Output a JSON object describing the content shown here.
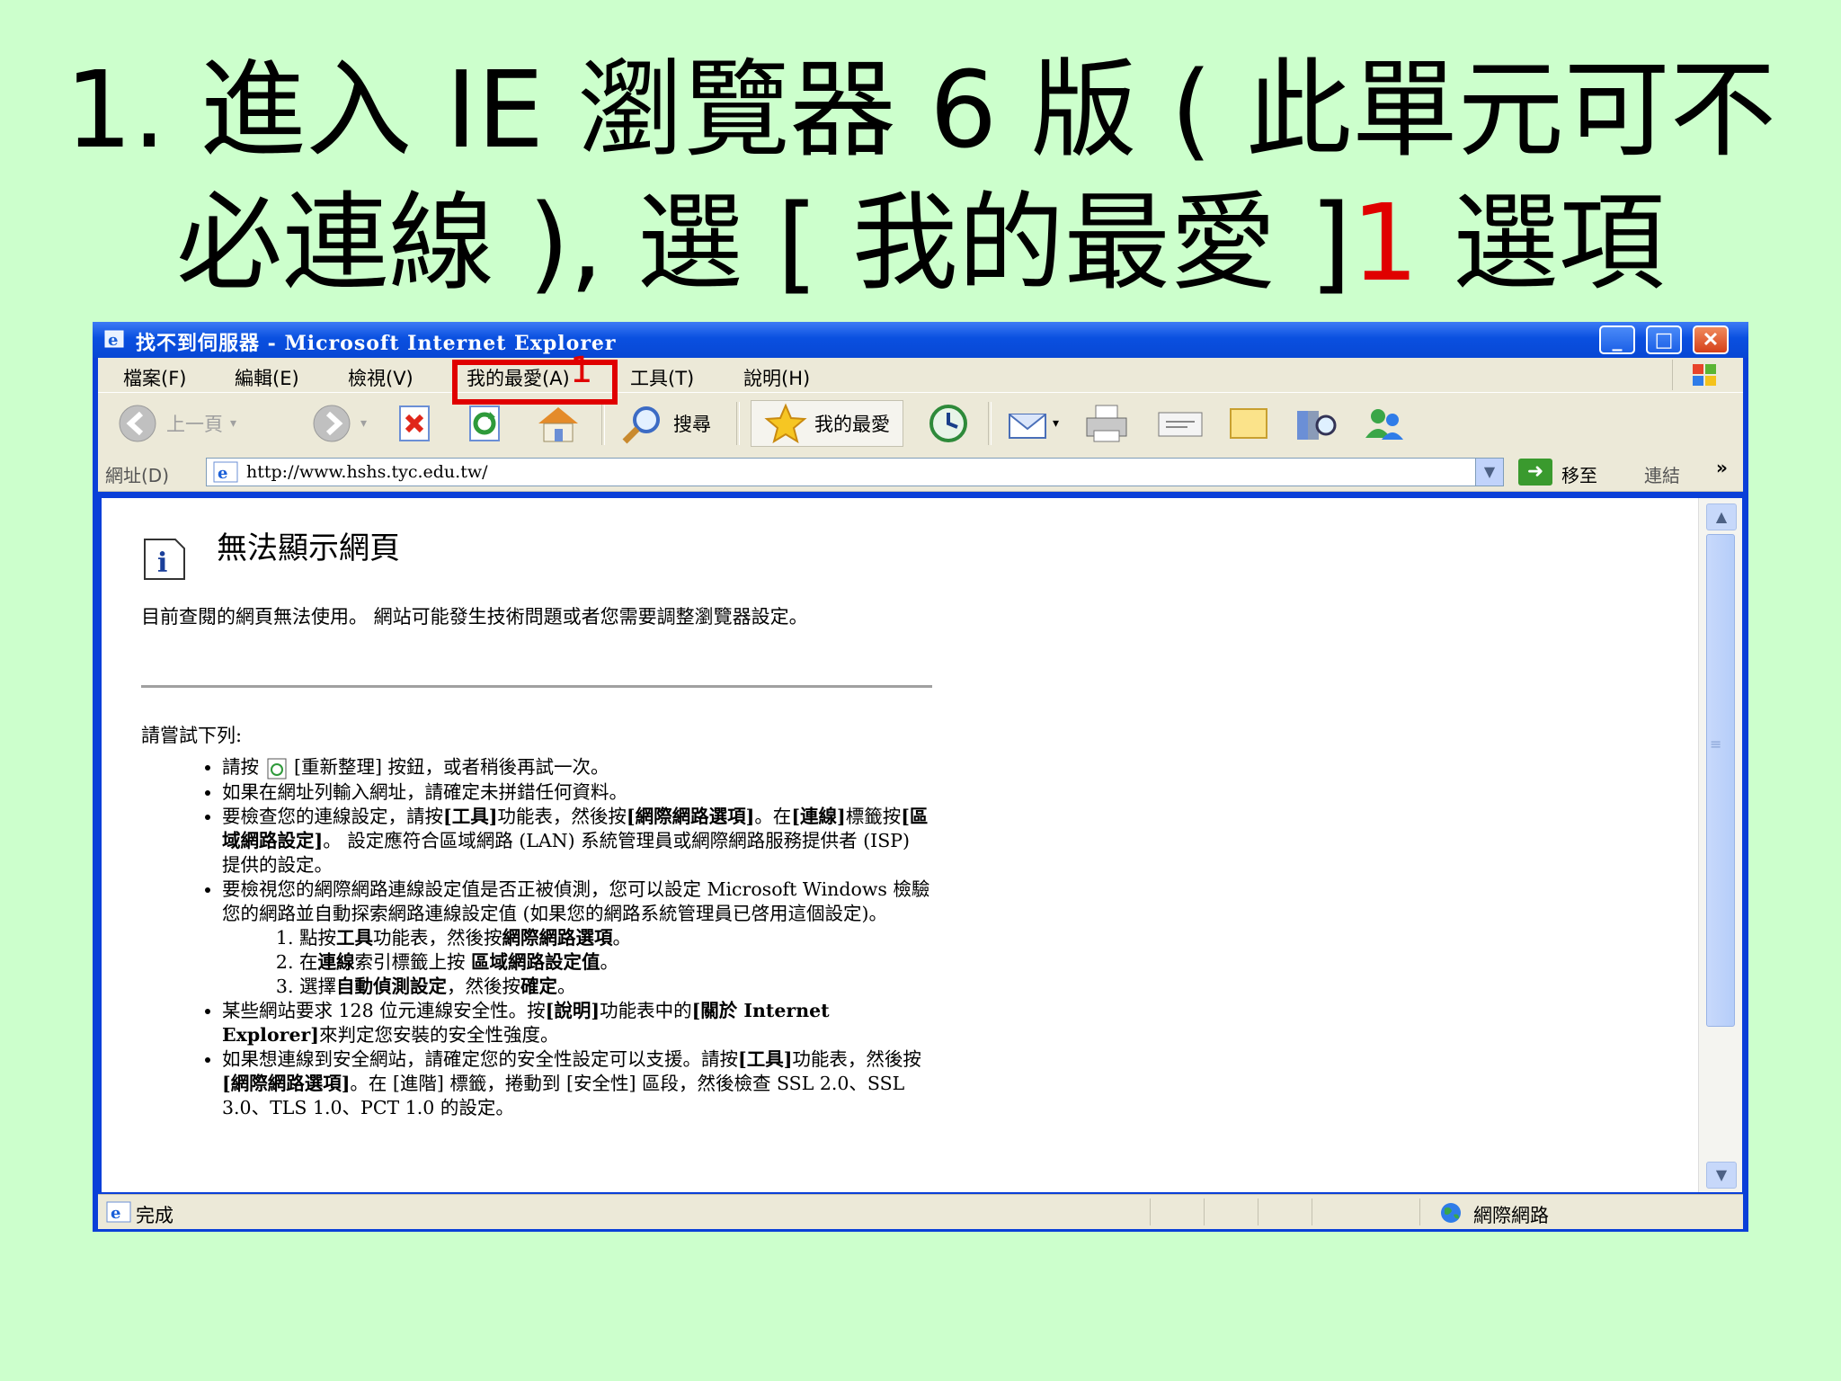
{
  "slide": {
    "title_line1": "1. 進入 IE 瀏覽器 6 版 ( 此單元可不",
    "title_line2_a": "必連線 ),  選 [ 我的最愛 ]",
    "title_line2_num": "1",
    "title_line2_b": " 選項",
    "marker_number": "1",
    "marker_color": "#e00000",
    "background_color": "#ccffcc"
  },
  "window": {
    "title": "找不到伺服器 - Microsoft Internet Explorer",
    "buttons": {
      "minimize": "_",
      "maximize": "□",
      "close": "✕"
    }
  },
  "menubar": {
    "items": [
      "檔案(F)",
      "編輯(E)",
      "檢視(V)",
      "我的最愛(A)",
      "工具(T)",
      "說明(H)"
    ]
  },
  "toolbar": {
    "back_label": "上一頁",
    "search_label": "搜尋",
    "favorites_label": "我的最愛"
  },
  "address_bar": {
    "label": "網址(D)",
    "url": "http://www.hshs.tyc.edu.tw/",
    "go_label": "移至",
    "links_label": "連結",
    "more_glyph": "»"
  },
  "page": {
    "title": "無法顯示網頁",
    "description": "目前查閱的網頁無法使用。 網站可能發生技術問題或者您需要調整瀏覽器設定。",
    "try_label": "請嘗試下列:",
    "tips": {
      "t1_a": "請按 ",
      "t1_b": " [重新整理] 按鈕，或者稍後再試一次。",
      "t2": "如果在網址列輸入網址，請確定未拼錯任何資料。",
      "t3_a": "要檢查您的連線設定，請按",
      "t3_b": "[工具]",
      "t3_c": "功能表，然後按",
      "t3_d": "[網際網路選項]",
      "t3_e": "。在",
      "t3_f": "[連線]",
      "t3_g": "標籤按",
      "t3_h": "[區域網路設定]",
      "t3_i": "。 設定應符合區域網路 (LAN) 系統管理員或網際網路服務提供者 (ISP) 提供的設定。",
      "t4": "要檢視您的網際網路連線設定值是否正被偵測，您可以設定 Microsoft Windows 檢驗您的網路並自動探索網路連線設定值 (如果您的網路系統管理員已啓用這個設定)。",
      "t4_steps": [
        {
          "a": "點按",
          "b": "工具",
          "c": "功能表，然後按",
          "d": "網際網路選項",
          "e": "。"
        },
        {
          "a": "在",
          "b": "連線",
          "c": "索引標籤上按 ",
          "d": "區域網路設定值",
          "e": "。"
        },
        {
          "a": "選擇",
          "b": "自動偵測設定",
          "c": "，然後按",
          "d": "確定",
          "e": "。"
        }
      ],
      "t5_a": "某些網站要求 128 位元連線安全性。按",
      "t5_b": "[說明]",
      "t5_c": "功能表中的",
      "t5_d": "[關於 Internet Explorer]",
      "t5_e": "來判定您安裝的安全性強度。",
      "t6_a": "如果想連線到安全網站，請確定您的安全性設定可以支援。請按",
      "t6_b": "[工具]",
      "t6_c": "功能表，然後按",
      "t6_d": "[網際網路選項]",
      "t6_e": "。在 [進階] 標籤，捲動到 [安全性] 區段，然後檢查 SSL 2.0、SSL 3.0、TLS 1.0、PCT 1.0 的設定。"
    }
  },
  "statusbar": {
    "status": "完成",
    "zone": "網際網路"
  },
  "icons": [
    "ie-icon",
    "back-arrow-icon",
    "forward-arrow-icon",
    "stop-icon",
    "refresh-icon",
    "home-icon",
    "search-icon",
    "favorites-star-icon",
    "history-icon",
    "mail-icon",
    "print-icon",
    "edit-icon",
    "discuss-icon",
    "research-icon",
    "messenger-icon",
    "go-arrow-icon",
    "info-icon",
    "globe-icon"
  ]
}
